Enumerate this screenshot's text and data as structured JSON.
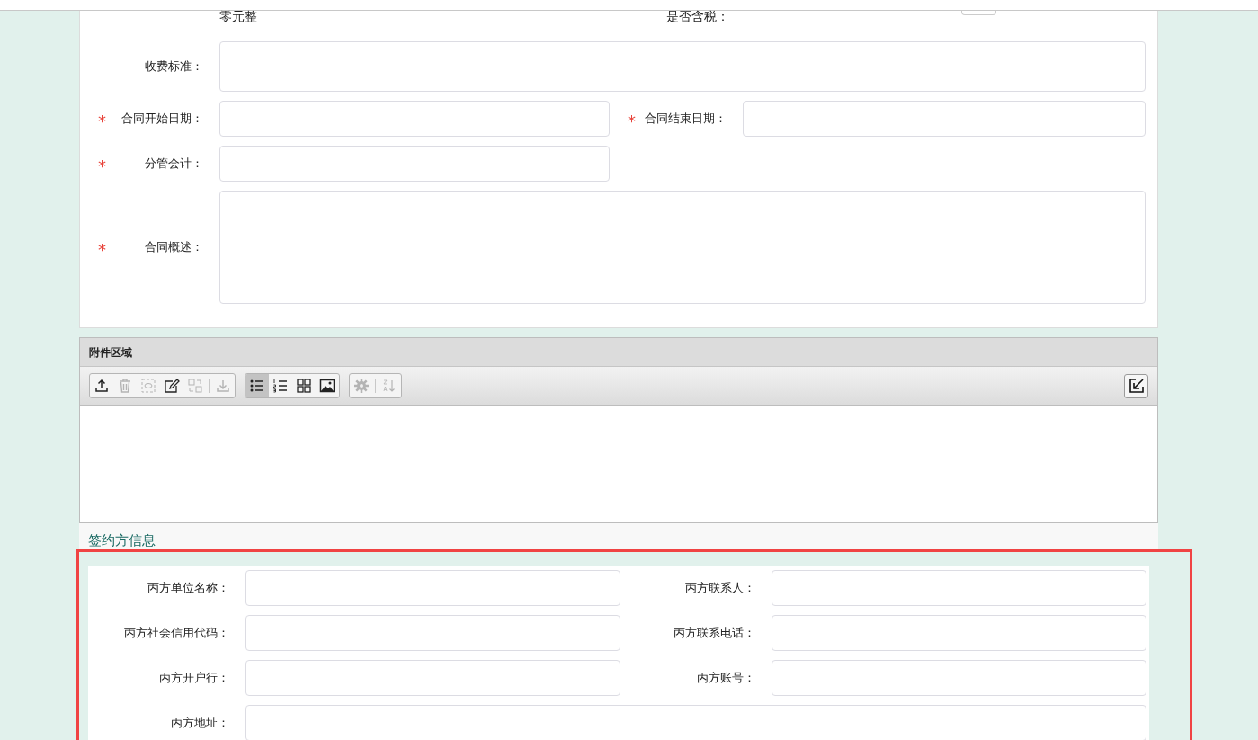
{
  "top_row": {
    "amount_text": "零元整",
    "tax_label": "是否含税："
  },
  "contract_form": {
    "rows": [
      {
        "fields": [
          {
            "label": "收费标准：",
            "kind": "textarea"
          }
        ]
      },
      {
        "fields": [
          {
            "label": "合同开始日期：",
            "required_mark": "*",
            "kind": "input"
          },
          {
            "label": "合同结束日期：",
            "required_mark": "*",
            "kind": "input"
          }
        ]
      },
      {
        "fields": [
          {
            "label": "分管会计：",
            "required_mark": "*",
            "kind": "input"
          }
        ]
      },
      {
        "fields": [
          {
            "label": "合同概述：",
            "required_mark": "*",
            "kind": "tall-textarea"
          }
        ]
      }
    ]
  },
  "attachments": {
    "title": "附件区域",
    "toolbar_groups": [
      {
        "buttons": [
          {
            "kind": "upload",
            "disabled": false,
            "selected": false
          },
          {
            "kind": "delete",
            "disabled": true,
            "selected": false
          },
          {
            "kind": "preview",
            "disabled": true,
            "selected": false
          },
          {
            "kind": "edit",
            "disabled": false,
            "selected": false
          },
          {
            "kind": "replace",
            "disabled": true,
            "selected": false
          },
          {
            "kind": "separator"
          },
          {
            "kind": "download",
            "disabled": true,
            "selected": false
          }
        ]
      },
      {
        "buttons": [
          {
            "kind": "list",
            "disabled": false,
            "selected": true
          },
          {
            "kind": "numbered-list",
            "disabled": false,
            "selected": false
          },
          {
            "kind": "grid",
            "disabled": false,
            "selected": false
          },
          {
            "kind": "image",
            "disabled": false,
            "selected": false
          }
        ]
      },
      {
        "buttons": [
          {
            "kind": "settings",
            "disabled": true,
            "selected": false
          },
          {
            "kind": "separator"
          },
          {
            "kind": "sort",
            "disabled": true,
            "selected": false
          }
        ]
      }
    ],
    "collapse_button": true
  },
  "signatory_section": {
    "title": "签约方信息",
    "highlighted": true,
    "rows": [
      {
        "fields": [
          {
            "label": "丙方单位名称："
          },
          {
            "label": "丙方联系人："
          }
        ]
      },
      {
        "fields": [
          {
            "label": "丙方社会信用代码："
          },
          {
            "label": "丙方联系电话："
          }
        ]
      },
      {
        "fields": [
          {
            "label": "丙方开户行："
          },
          {
            "label": "丙方账号："
          }
        ]
      },
      {
        "fields": [
          {
            "label": "丙方地址："
          }
        ]
      }
    ]
  }
}
